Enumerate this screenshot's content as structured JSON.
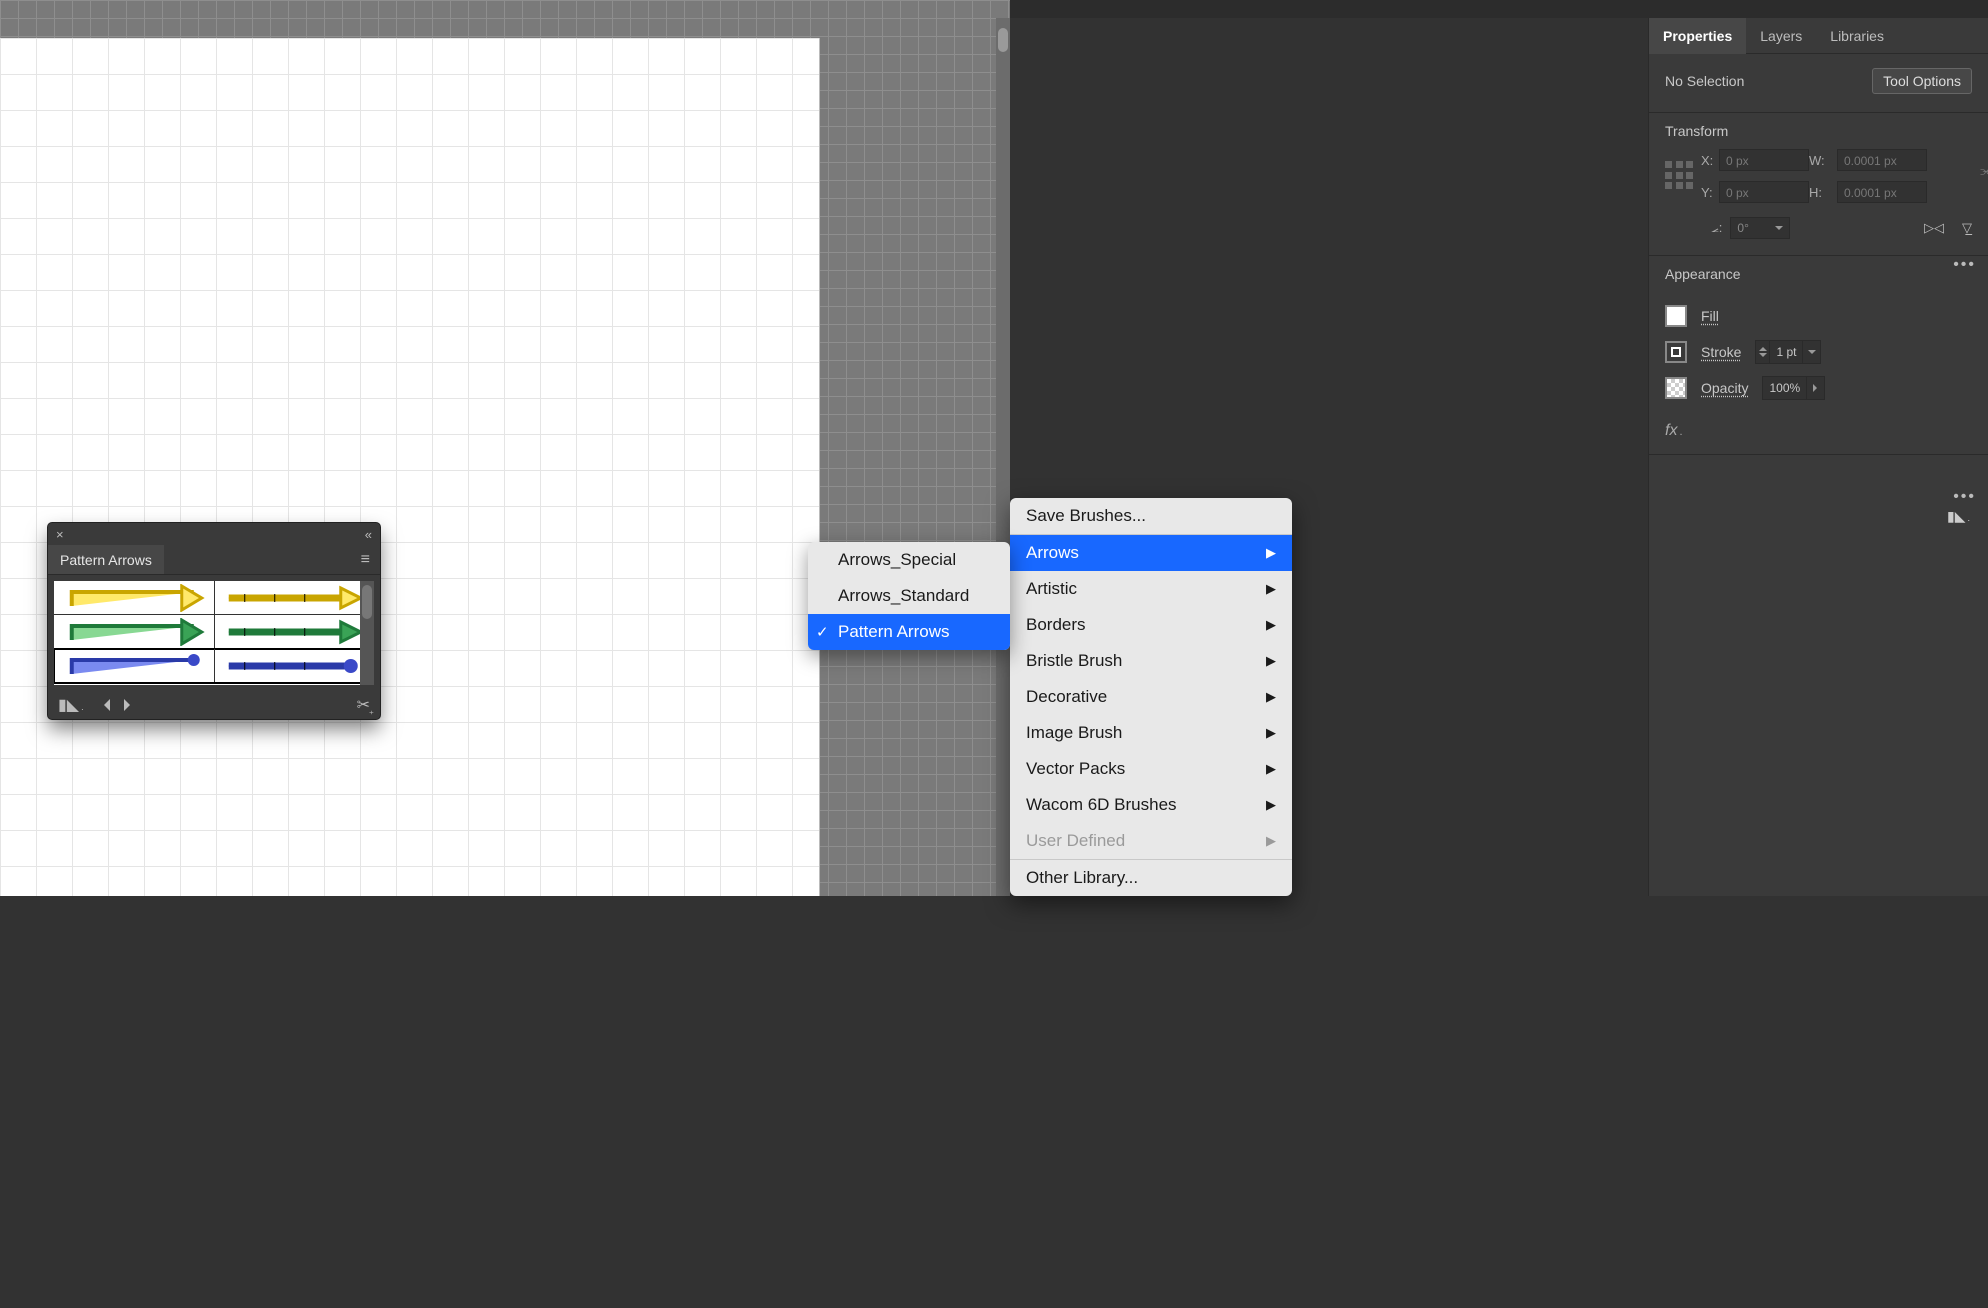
{
  "tabs": {
    "properties": "Properties",
    "layers": "Layers",
    "libraries": "Libraries"
  },
  "properties": {
    "no_selection": "No Selection",
    "tool_options": "Tool Options",
    "transform_label": "Transform",
    "x_label": "X:",
    "x_val": "0 px",
    "y_label": "Y:",
    "y_val": "0 px",
    "w_label": "W:",
    "w_val": "0.0001 px",
    "h_label": "H:",
    "h_val": "0.0001 px",
    "angle_label": "⦟:",
    "angle_val": "0°",
    "appearance_label": "Appearance",
    "fill_label": "Fill",
    "stroke_label": "Stroke",
    "stroke_val": "1 pt",
    "opacity_label": "Opacity",
    "opacity_val": "100%",
    "fx_label": "fx"
  },
  "library_menu": {
    "save": "Save Brushes...",
    "categories": [
      {
        "label": "Arrows",
        "highlight": true
      },
      {
        "label": "Artistic"
      },
      {
        "label": "Borders"
      },
      {
        "label": "Bristle Brush"
      },
      {
        "label": "Decorative"
      },
      {
        "label": "Image Brush"
      },
      {
        "label": "Vector Packs"
      },
      {
        "label": "Wacom 6D Brushes"
      },
      {
        "label": "User Defined",
        "disabled": true
      }
    ],
    "other": "Other Library..."
  },
  "submenu": {
    "items": [
      {
        "label": "Arrows_Special"
      },
      {
        "label": "Arrows_Standard"
      },
      {
        "label": "Pattern Arrows",
        "checked": true,
        "highlight": true
      }
    ]
  },
  "float_panel": {
    "title": "Pattern Arrows"
  }
}
